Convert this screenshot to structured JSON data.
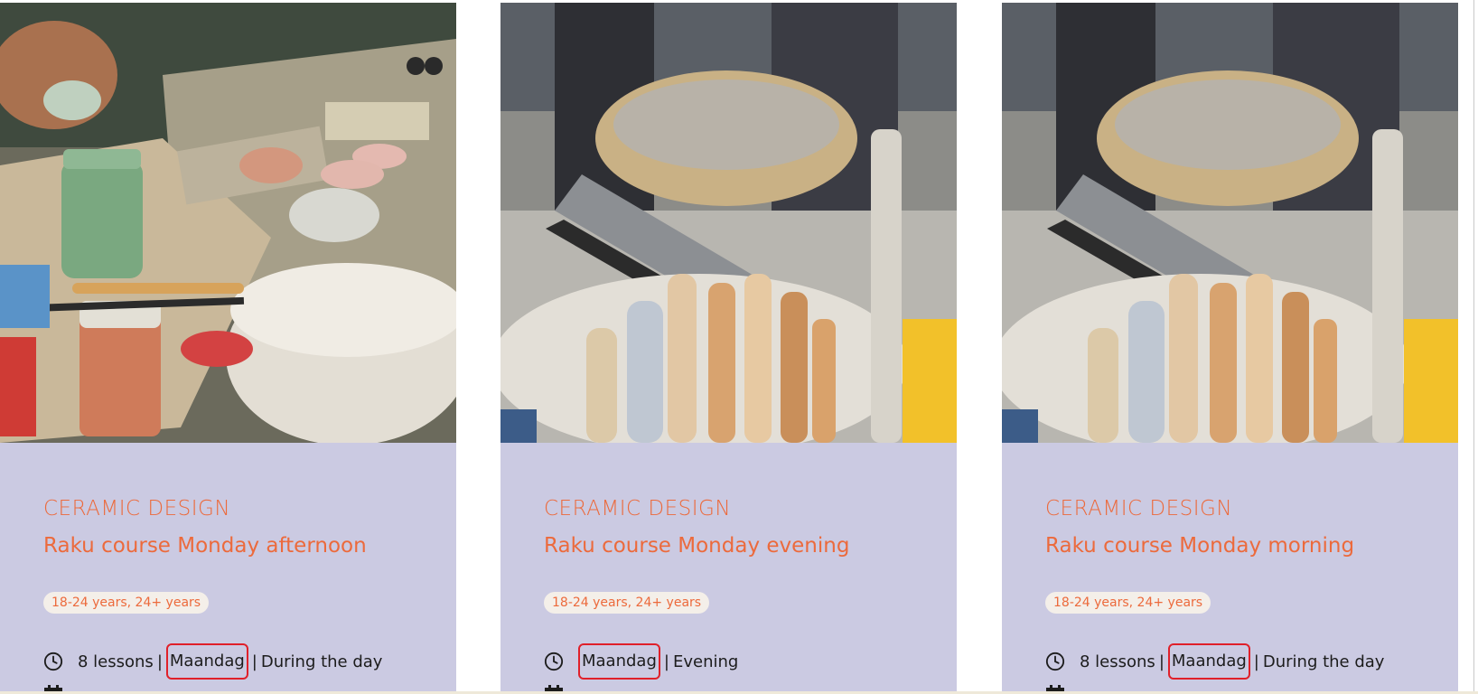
{
  "cards": [
    {
      "category": "CERAMIC DESIGN",
      "title": "Raku course Monday afternoon",
      "ages": "18-24 years, 24+ years",
      "lessons": "8 lessons",
      "day": "Maandag",
      "time": "During the day"
    },
    {
      "category": "CERAMIC DESIGN",
      "title": "Raku course Monday evening",
      "ages": "18-24 years, 24+ years",
      "lessons": "",
      "day": "Maandag",
      "time": "Evening"
    },
    {
      "category": "CERAMIC DESIGN",
      "title": "Raku course Monday morning",
      "ages": "18-24 years, 24+ years",
      "lessons": "8 lessons",
      "day": "Maandag",
      "time": "During the day"
    }
  ],
  "icons": {
    "meta": "clock-icon",
    "date": "calendar-icon"
  },
  "colors": {
    "card_background": "#cbcae2",
    "accent": "#ec6a3c",
    "badge_background": "#f4efe9",
    "highlight": "#e0202a"
  },
  "separator": "|"
}
